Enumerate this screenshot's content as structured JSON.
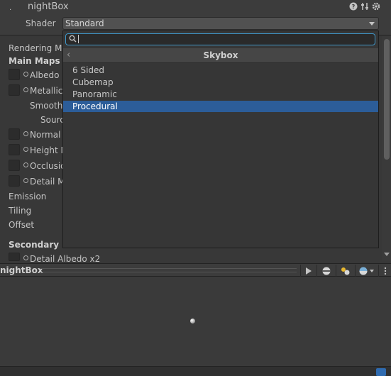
{
  "header": {
    "title": "nightBox",
    "shader_label": "Shader",
    "shader_value": "Standard",
    "icons": [
      "help-icon",
      "settings-sliders-icon",
      "gear-icon"
    ]
  },
  "inspector": {
    "rendering_mode_label": "Rendering Mo",
    "main_maps_label": "Main Maps",
    "albedo_label": "Albedo",
    "metallic_label": "Metallic",
    "smoothness_label": "Smoothn",
    "source_label": "Sourc",
    "normal_label": "Normal I",
    "height_label": "Height M",
    "occlusion_label": "Occlusio",
    "detail_mask_label": "Detail M",
    "emission_label": "Emission",
    "tiling_label": "Tiling",
    "offset_label": "Offset",
    "secondary_maps_label": "Secondary M",
    "detail_albedo_label": "Detail Albedo x2"
  },
  "popup": {
    "search_value": "",
    "title": "Skybox",
    "items": [
      {
        "label": "6 Sided",
        "selected": false
      },
      {
        "label": "Cubemap",
        "selected": false
      },
      {
        "label": "Panoramic",
        "selected": false
      },
      {
        "label": "Procedural",
        "selected": true
      }
    ]
  },
  "scene": {
    "title": "nightBox",
    "toolbar_icons": [
      "play-icon",
      "sphere-preview-icon",
      "lights-icon",
      "sky-sphere-icon",
      "more-icon"
    ]
  },
  "colors": {
    "background": "#383838",
    "selection": "#2c5d99",
    "search_focus": "#3e96c8"
  }
}
